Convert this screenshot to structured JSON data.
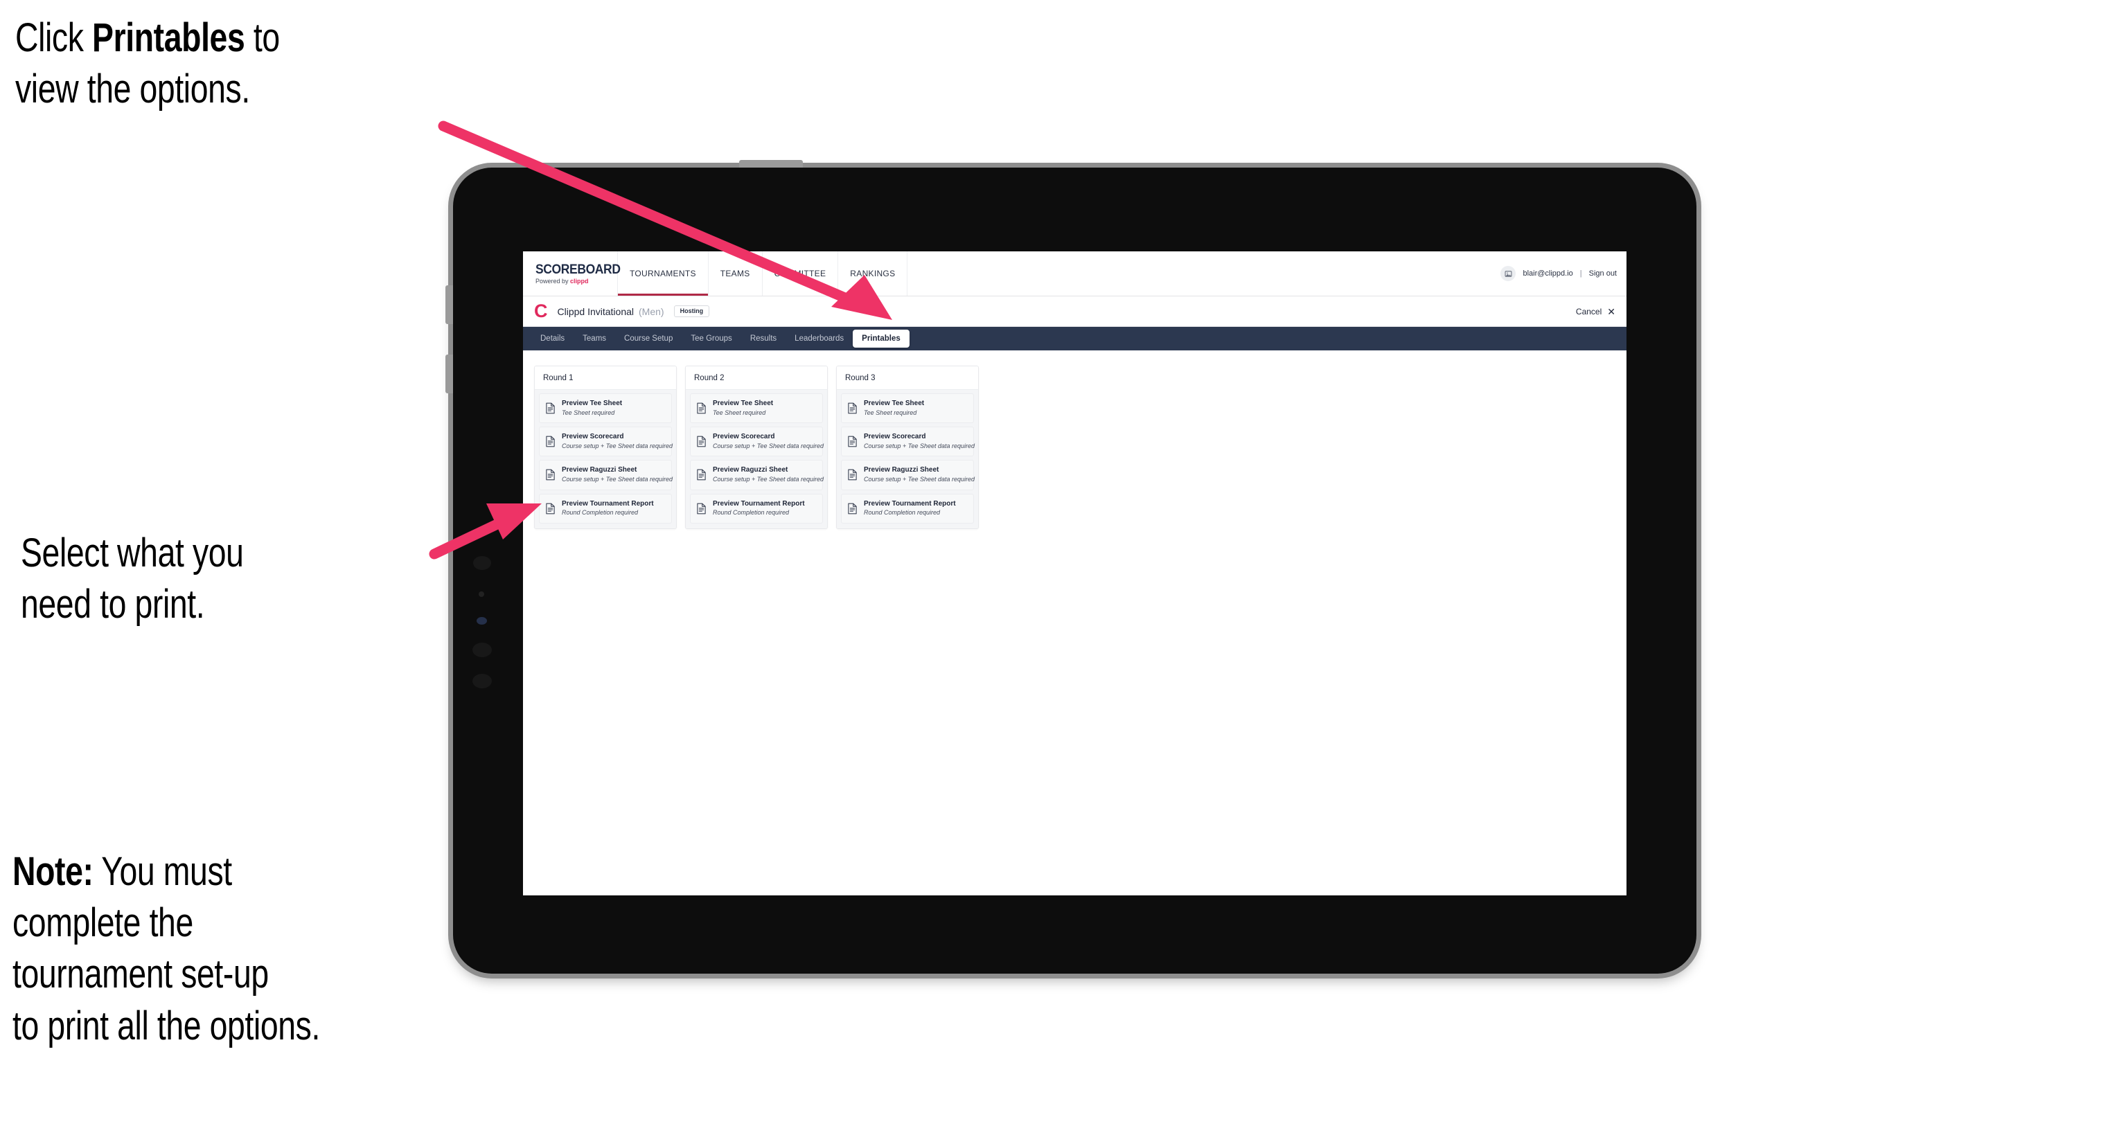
{
  "annotations": [
    {
      "id": "annot-1",
      "prefix": "Click ",
      "bold": "Printables",
      "suffix": " to\nview the options."
    },
    {
      "id": "annot-2",
      "prefix": "Select what you\n need to print.",
      "bold": "",
      "suffix": ""
    },
    {
      "id": "annot-3",
      "prefix": "",
      "bold": "Note:",
      "suffix": " You must\ncomplete the\ntournament set-up\nto print all the options."
    }
  ],
  "annotation_text": {
    "one_prefix": "Click ",
    "one_bold": "Printables",
    "one_suffix": " to\nview the options.",
    "two": "Select what you\n need to print.",
    "three_bold": "Note:",
    "three_rest": " You must\ncomplete the\ntournament set-up\nto print all the options."
  },
  "app": {
    "brand": {
      "title": "SCOREBOARD",
      "powered_by_prefix": "Powered by ",
      "powered_by_accent": "clippd"
    },
    "topnav": [
      {
        "label": "TOURNAMENTS",
        "active": true
      },
      {
        "label": "TEAMS",
        "active": false
      },
      {
        "label": "COMMITTEE",
        "active": false
      },
      {
        "label": "RANKINGS",
        "active": false
      }
    ],
    "account": {
      "avatar_icon": "user-avatar-icon",
      "email": "blair@clippd.io",
      "separator": "|",
      "sign_out": "Sign out"
    },
    "subheader": {
      "logo_glyph": "C",
      "tournament_name": "Clippd Invitational",
      "gender": "(Men)",
      "badge": "Hosting",
      "cancel_label": "Cancel",
      "cancel_icon": "✕"
    },
    "tabs": [
      {
        "label": "Details",
        "active": false
      },
      {
        "label": "Teams",
        "active": false
      },
      {
        "label": "Course Setup",
        "active": false
      },
      {
        "label": "Tee Groups",
        "active": false
      },
      {
        "label": "Results",
        "active": false
      },
      {
        "label": "Leaderboards",
        "active": false
      },
      {
        "label": "Printables",
        "active": true
      }
    ],
    "rounds": [
      {
        "header": "Round 1",
        "items": [
          {
            "title": "Preview Tee Sheet",
            "sub": "Tee Sheet required"
          },
          {
            "title": "Preview Scorecard",
            "sub": "Course setup + Tee Sheet data required"
          },
          {
            "title": "Preview Raguzzi Sheet",
            "sub": "Course setup + Tee Sheet data required"
          },
          {
            "title": "Preview Tournament Report",
            "sub": "Round Completion required"
          }
        ]
      },
      {
        "header": "Round 2",
        "items": [
          {
            "title": "Preview Tee Sheet",
            "sub": "Tee Sheet required"
          },
          {
            "title": "Preview Scorecard",
            "sub": "Course setup + Tee Sheet data required"
          },
          {
            "title": "Preview Raguzzi Sheet",
            "sub": "Course setup + Tee Sheet data required"
          },
          {
            "title": "Preview Tournament Report",
            "sub": "Round Completion required"
          }
        ]
      },
      {
        "header": "Round 3",
        "items": [
          {
            "title": "Preview Tee Sheet",
            "sub": "Tee Sheet required"
          },
          {
            "title": "Preview Scorecard",
            "sub": "Course setup + Tee Sheet data required"
          },
          {
            "title": "Preview Raguzzi Sheet",
            "sub": "Course setup + Tee Sheet data required"
          },
          {
            "title": "Preview Tournament Report",
            "sub": "Round Completion required"
          }
        ]
      }
    ]
  },
  "colors": {
    "arrow_pink": "#ee3366",
    "tabs_bar": "#2c3850",
    "brand_accent": "#e0295d",
    "nav_underline": "#b02a46",
    "device_body": "#0d0d0d",
    "device_edge": "#8e8e8e"
  }
}
